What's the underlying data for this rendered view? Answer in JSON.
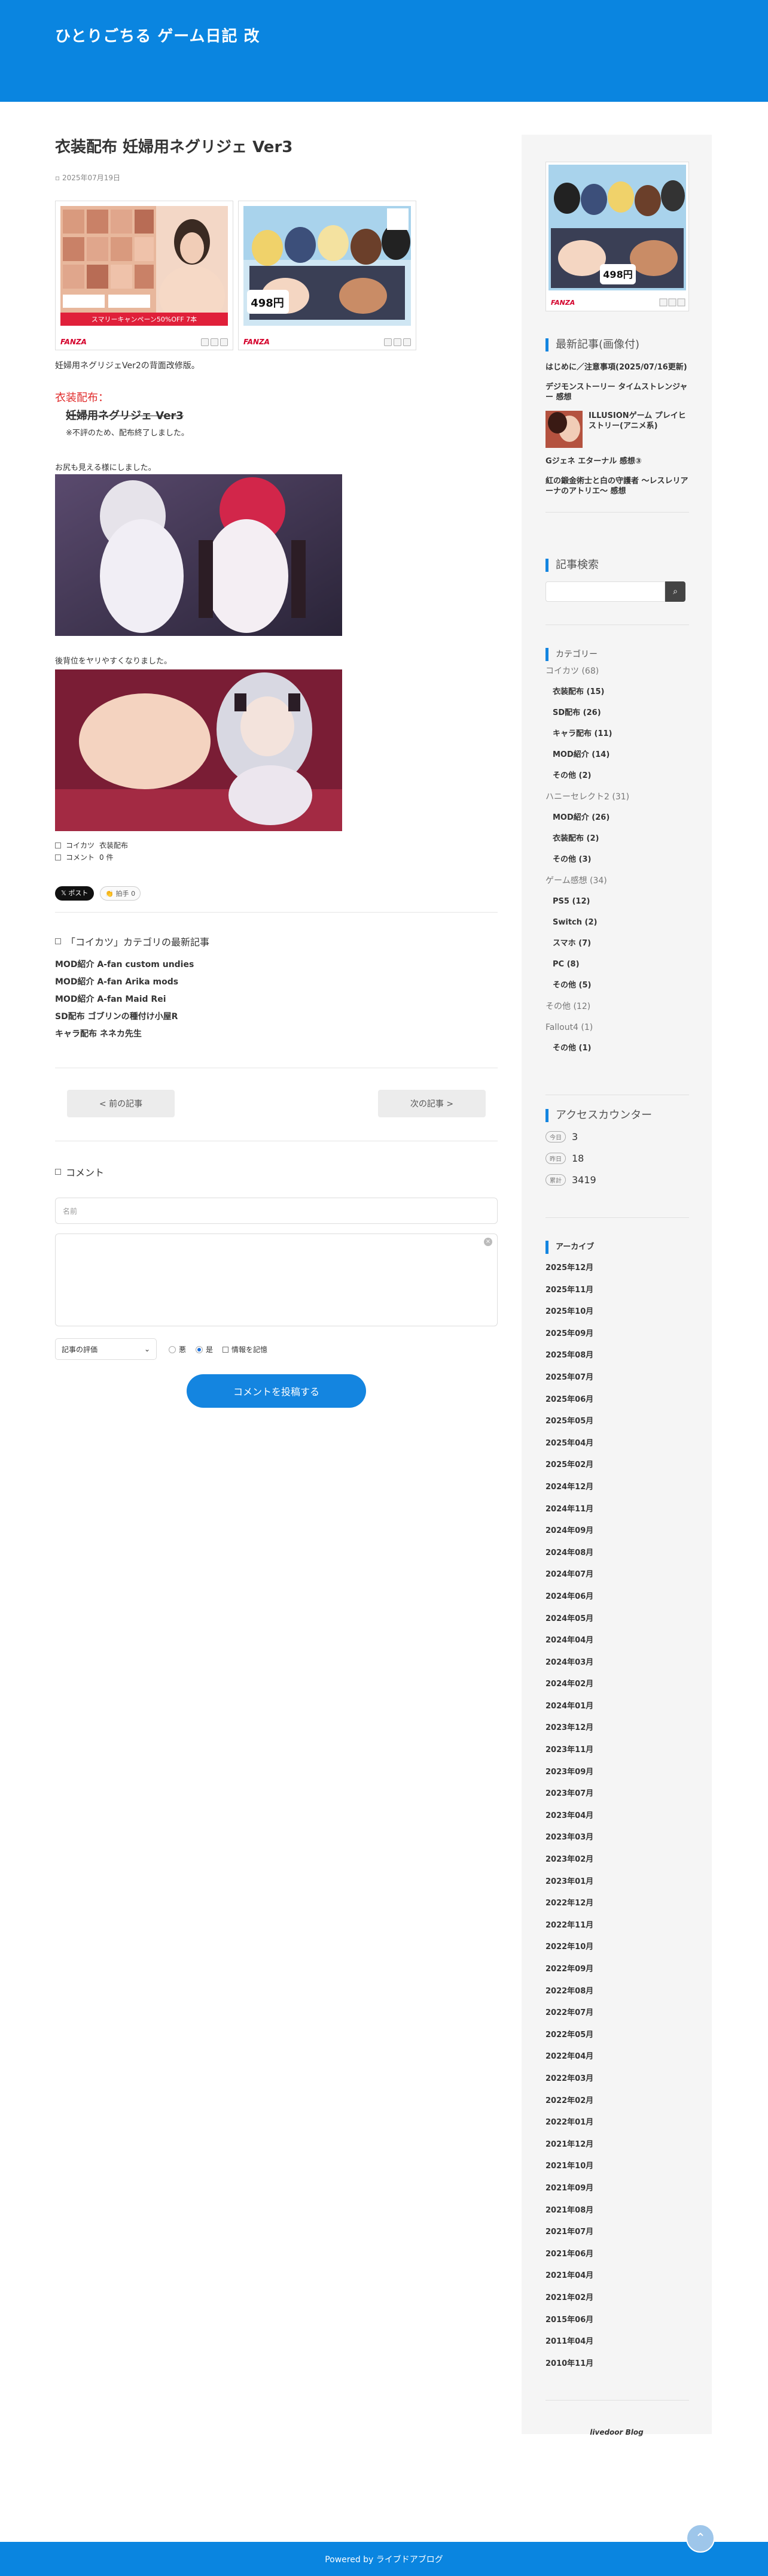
{
  "site": {
    "title": "ひとりごちる ゲーム日記 改"
  },
  "post": {
    "title": "衣装配布 妊婦用ネグリジェ Ver3",
    "date": "2025年07月19日",
    "intro": "妊婦用ネグリジェVer2の背面改修版。",
    "dist_label": "衣装配布：",
    "dist_item": "妊婦用ネグリジェ Ver3",
    "dist_note": "※不評のため、配布終了しました。",
    "caption1": "お尻も見える様にしました。",
    "caption2": "後背位をヤリやすくなりました。",
    "category_label": "コイカツ",
    "category_value": "衣装配布",
    "comment_label": "コメント",
    "comment_count": "0 件"
  },
  "ads": [
    {
      "banner": "スマリーキャンペーン50%OFF 7本",
      "logo": "FANZA"
    },
    {
      "price": "498円",
      "logo": "FANZA"
    }
  ],
  "social": {
    "x_label": "𝕏 ポスト",
    "clap_label": "👏 拍手",
    "clap_count": "0"
  },
  "related": {
    "heading": "「コイカツ」カテゴリの最新記事",
    "items": [
      "MOD紹介 A-fan custom undies",
      "MOD紹介 A-fan Arika mods",
      "MOD紹介 A-fan Maid Rei",
      "SD配布 ゴブリンの種付け小屋R",
      "キャラ配布 ネネカ先生"
    ]
  },
  "nav": {
    "prev": "< 前の記事",
    "next": "次の記事 >"
  },
  "comment_form": {
    "heading": "コメント",
    "name_placeholder": "名前",
    "rating_select": "記事の評価",
    "radio_bad": "悪",
    "radio_good": "是",
    "remember": "情報を記憶",
    "submit": "コメントを投稿する"
  },
  "sidebar": {
    "recent_heading": "最新記事(画像付)",
    "recent": [
      "はじめに／注意事項(2025/07/16更新)",
      "デジモンストーリー タイムストレンジャー 感想",
      "ILLUSIONゲーム プレイヒストリー(アニメ系)",
      "Gジェネ エターナル 感想③",
      "紅の鍛金術士と白の守護者 〜レスレリアーナのアトリエ〜 感想"
    ],
    "search_heading": "記事検索",
    "category_heading": "カテゴリー",
    "categories": [
      {
        "name": "コイカツ (68)",
        "level": "p"
      },
      {
        "name": "衣装配布 (15)",
        "level": "c"
      },
      {
        "name": "SD配布 (26)",
        "level": "c"
      },
      {
        "name": "キャラ配布 (11)",
        "level": "c"
      },
      {
        "name": "MOD紹介 (14)",
        "level": "c"
      },
      {
        "name": "その他 (2)",
        "level": "c"
      },
      {
        "name": "ハニーセレクト2 (31)",
        "level": "p"
      },
      {
        "name": "MOD紹介 (26)",
        "level": "c"
      },
      {
        "name": "衣装配布 (2)",
        "level": "c"
      },
      {
        "name": "その他 (3)",
        "level": "c"
      },
      {
        "name": "ゲーム感想 (34)",
        "level": "p"
      },
      {
        "name": "PS5 (12)",
        "level": "c"
      },
      {
        "name": "Switch (2)",
        "level": "c"
      },
      {
        "name": "スマホ (7)",
        "level": "c"
      },
      {
        "name": "PC (8)",
        "level": "c"
      },
      {
        "name": "その他 (5)",
        "level": "c"
      },
      {
        "name": "その他 (12)",
        "level": "p"
      },
      {
        "name": "Fallout4 (1)",
        "level": "p"
      },
      {
        "name": "その他 (1)",
        "level": "c"
      }
    ],
    "counter_heading": "アクセスカウンター",
    "counters": [
      {
        "label": "今日",
        "value": "3"
      },
      {
        "label": "昨日",
        "value": "18"
      },
      {
        "label": "累計",
        "value": "3419"
      }
    ],
    "archive_heading": "アーカイブ",
    "archives": [
      "2025年12月",
      "2025年11月",
      "2025年10月",
      "2025年09月",
      "2025年08月",
      "2025年07月",
      "2025年06月",
      "2025年05月",
      "2025年04月",
      "2025年02月",
      "2024年12月",
      "2024年11月",
      "2024年09月",
      "2024年08月",
      "2024年07月",
      "2024年06月",
      "2024年05月",
      "2024年04月",
      "2024年03月",
      "2024年02月",
      "2024年01月",
      "2023年12月",
      "2023年11月",
      "2023年09月",
      "2023年07月",
      "2023年04月",
      "2023年03月",
      "2023年02月",
      "2023年01月",
      "2022年12月",
      "2022年11月",
      "2022年10月",
      "2022年09月",
      "2022年08月",
      "2022年07月",
      "2022年05月",
      "2022年04月",
      "2022年03月",
      "2022年02月",
      "2022年01月",
      "2021年12月",
      "2021年10月",
      "2021年09月",
      "2021年08月",
      "2021年07月",
      "2021年06月",
      "2021年04月",
      "2021年02月",
      "2015年06月",
      "2011年04月",
      "2010年11月"
    ],
    "livedoor_blog": "livedoor Blog"
  },
  "footer": {
    "text": "Powered by ライブドアブログ"
  },
  "colors": {
    "brand": "#0a85e0",
    "accent_red": "#e02b2b"
  }
}
